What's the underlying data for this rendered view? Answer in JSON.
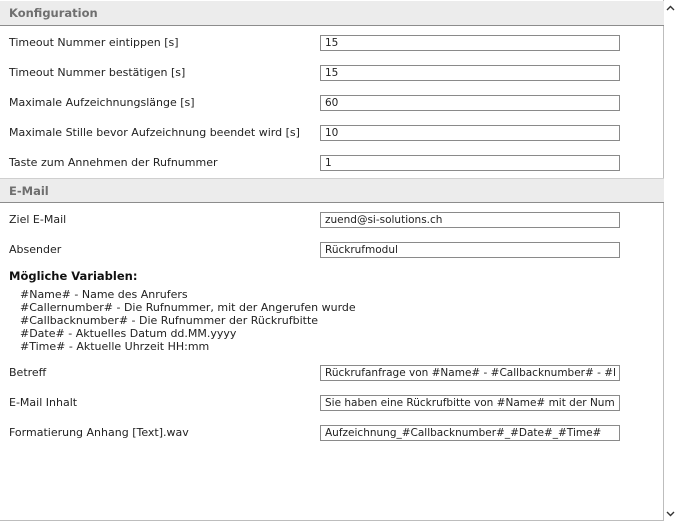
{
  "sections": {
    "config": {
      "title": "Konfiguration",
      "rows": [
        {
          "label": "Timeout Nummer eintippen [s]",
          "value": "15"
        },
        {
          "label": "Timeout Nummer bestätigen [s]",
          "value": "15"
        },
        {
          "label": "Maximale Aufzeichnungslänge [s]",
          "value": "60"
        },
        {
          "label": "Maximale Stille bevor Aufzeichnung beendet wird [s]",
          "value": "10"
        },
        {
          "label": "Taste zum Annehmen der Rufnummer",
          "value": "1"
        }
      ]
    },
    "email": {
      "title": "E-Mail",
      "rows": [
        {
          "label": "Ziel E-Mail",
          "value": "zuend@si-solutions.ch"
        },
        {
          "label": "Absender",
          "value": "Rückrufmodul"
        }
      ],
      "variables_title": "Mögliche Variablen:",
      "variables": [
        "#Name# - Name des Anrufers",
        "#Callernumber# - Die Rufnummer, mit der Angerufen wurde",
        "#Callbacknumber# - Die Rufnummer der Rückrufbitte",
        "#Date# - Aktuelles Datum dd.MM.yyyy",
        "#Time# - Aktuelle Uhrzeit HH:mm"
      ],
      "rows2": [
        {
          "label": "Betreff",
          "value": "Rückrufanfrage von #Name# - #Callbacknumber# - #Date# #Time#"
        },
        {
          "label": "E-Mail Inhalt",
          "value": "Sie haben eine Rückrufbitte von #Name# mit der Nummer #Callbacknumber# erhalten."
        },
        {
          "label": "Formatierung Anhang [Text].wav",
          "value": "Aufzeichnung_#Callbacknumber#_#Date#_#Time#"
        }
      ]
    }
  },
  "scrollbar": {
    "up_icon": "scroll-up-arrow",
    "down_icon": "scroll-down-arrow"
  }
}
